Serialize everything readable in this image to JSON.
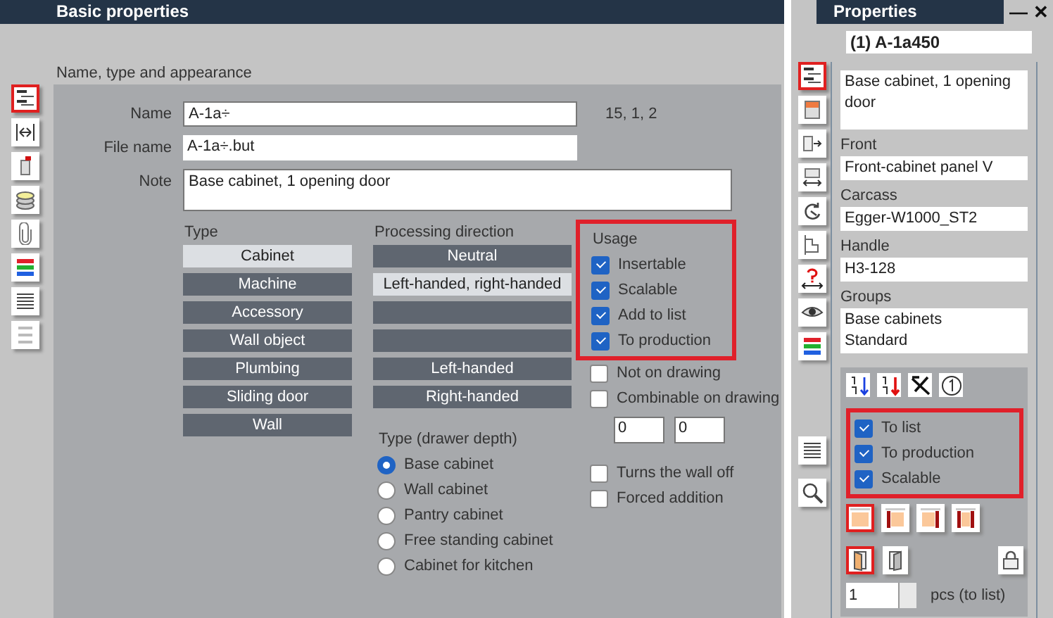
{
  "basic_properties": {
    "title": "Basic properties",
    "section": "Name, type and appearance",
    "tools": [
      {
        "selected": true
      },
      {
        "selected": false
      },
      {
        "selected": false
      },
      {
        "selected": false
      },
      {
        "selected": false
      },
      {
        "selected": false
      },
      {
        "selected": false
      },
      {
        "selected": false
      }
    ],
    "name": {
      "label": "Name",
      "value": "A-1a÷"
    },
    "counter": "15, 1, 2",
    "file_name": {
      "label": "File name",
      "value": "A-1a÷.but"
    },
    "note": {
      "label": "Note",
      "value": "Base cabinet, 1 opening door"
    },
    "type": {
      "heading": "Type",
      "options": [
        {
          "label": "Cabinet",
          "selected": true
        },
        {
          "label": "Machine",
          "selected": false
        },
        {
          "label": "Accessory",
          "selected": false
        },
        {
          "label": "Wall object",
          "selected": false
        },
        {
          "label": "Plumbing",
          "selected": false
        },
        {
          "label": "Sliding door",
          "selected": false
        },
        {
          "label": "Wall",
          "selected": false
        }
      ]
    },
    "processing_direction": {
      "heading": "Processing direction",
      "options": [
        {
          "label": "Neutral",
          "selected": false
        },
        {
          "label": "Left-handed, right-handed",
          "selected": true
        },
        {
          "selected": false
        },
        {
          "selected": false
        },
        {
          "label": "Left-handed",
          "selected": false
        },
        {
          "label": "Right-handed",
          "selected": false
        }
      ]
    },
    "drawer_depth": {
      "heading": "Type (drawer depth)",
      "options": [
        {
          "label": "Base cabinet",
          "selected": true
        },
        {
          "label": "Wall cabinet",
          "selected": false
        },
        {
          "label": "Pantry cabinet",
          "selected": false
        },
        {
          "label": "Free standing cabinet",
          "selected": false
        },
        {
          "label": "Cabinet for kitchen",
          "selected": false
        }
      ]
    },
    "usage": {
      "heading": "Usage",
      "highlighted": true,
      "items": [
        {
          "label": "Insertable",
          "checked": true
        },
        {
          "label": "Scalable",
          "checked": true
        },
        {
          "label": "Add to list",
          "checked": true
        },
        {
          "label": "To production",
          "checked": true
        }
      ]
    },
    "drawing_options": [
      {
        "label": "Not on drawing",
        "checked": false
      },
      {
        "label": "Combinable on drawing",
        "checked": false
      }
    ],
    "offsets": [
      "0",
      "0"
    ],
    "wall_options": [
      {
        "label": "Turns the wall off",
        "checked": false
      },
      {
        "label": "Forced addition",
        "checked": false
      }
    ]
  },
  "properties": {
    "title": "Properties",
    "controls": [
      "—",
      "✕"
    ],
    "object": "(1) A-1a450",
    "tools": [
      {
        "selected": true
      },
      {
        "selected": false
      },
      {
        "selected": false
      },
      {
        "selected": false
      },
      {
        "selected": false
      },
      {
        "selected": false
      },
      {
        "selected": false
      },
      {
        "selected": false
      },
      {
        "selected": false
      }
    ],
    "lower_tools": [
      {
        "selected": false
      },
      {
        "selected": false
      }
    ],
    "note": "Base cabinet, 1 opening door",
    "details": [
      {
        "label": "Front",
        "lines": [
          "Front-cabinet panel V"
        ]
      },
      {
        "label": "Carcass",
        "lines": [
          "Egger-W1000_ST2"
        ]
      },
      {
        "label": "Handle",
        "lines": [
          "H3-128"
        ]
      },
      {
        "label": "Groups",
        "lines": [
          "Base cabinets",
          "Standard"
        ]
      }
    ],
    "usage": {
      "highlighted": true,
      "items": [
        {
          "label": "To list",
          "checked": true
        },
        {
          "label": "To production",
          "checked": true
        },
        {
          "label": "Scalable",
          "checked": true
        }
      ]
    },
    "edge_options": [
      {
        "selected": true
      },
      {
        "selected": false
      },
      {
        "selected": false
      },
      {
        "selected": false
      }
    ],
    "door_options": [
      {
        "selected": true
      },
      {
        "selected": false
      }
    ],
    "quantity": "1",
    "quantity_unit": "pcs (to list)"
  }
}
